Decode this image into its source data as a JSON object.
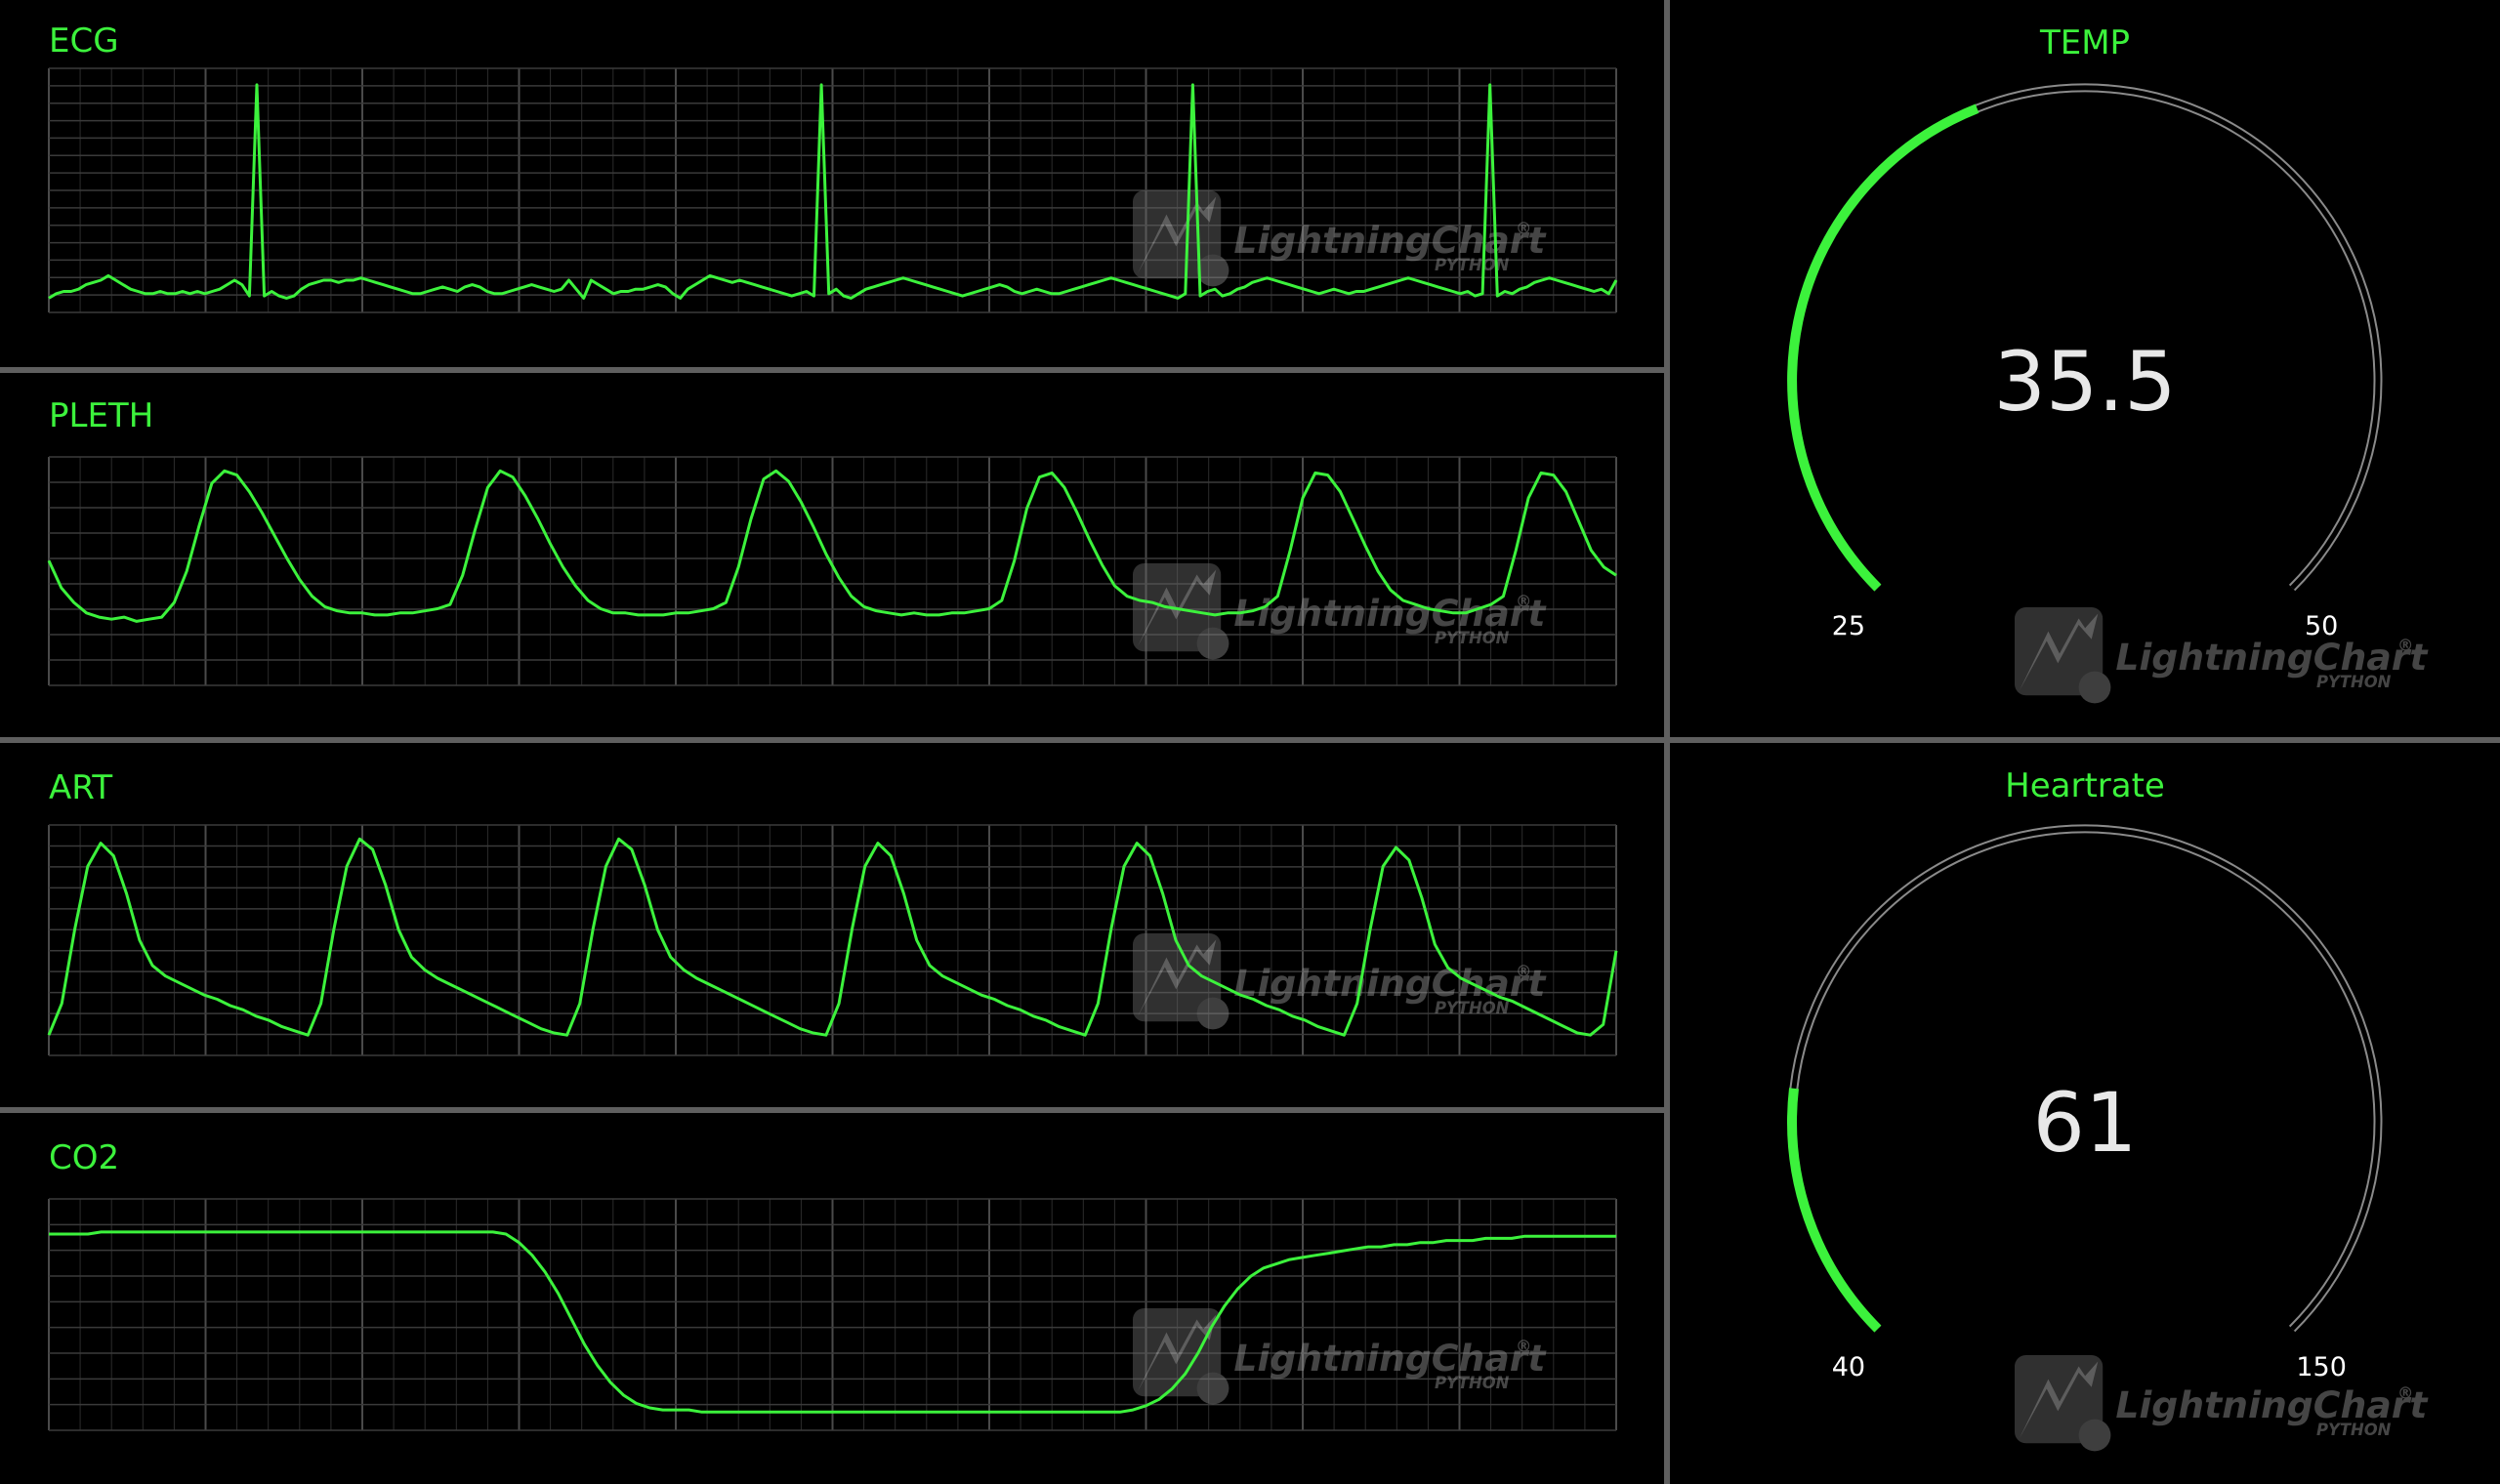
{
  "colors": {
    "background": "#000000",
    "trace": "#3cf23c",
    "grid": "#3a3a3a",
    "divider": "#5f5f5f",
    "gauge_track": "#9a9a9a",
    "value_text": "#e8e8e8",
    "tick_text": "#ffffff"
  },
  "watermark": {
    "brand": "LightningChart",
    "sub": "PYTHON",
    "icon": "lightning-python-logo-icon"
  },
  "chart_data": [
    {
      "type": "line",
      "title": "ECG",
      "xlabel": "",
      "ylabel": "",
      "grid": true,
      "series": [
        {
          "values": [
            0.02,
            0.04,
            0.05,
            0.05,
            0.06,
            0.08,
            0.09,
            0.1,
            0.12,
            0.1,
            0.08,
            0.06,
            0.05,
            0.04,
            0.04,
            0.05,
            0.04,
            0.04,
            0.05,
            0.04,
            0.05,
            0.04,
            0.05,
            0.06,
            0.08,
            0.1,
            0.08,
            0.03,
            0.97,
            0.03,
            0.05,
            0.03,
            0.02,
            0.03,
            0.06,
            0.08,
            0.09,
            0.1,
            0.1,
            0.09,
            0.1,
            0.1,
            0.11,
            0.1,
            0.09,
            0.08,
            0.07,
            0.06,
            0.05,
            0.04,
            0.04,
            0.05,
            0.06,
            0.07,
            0.06,
            0.05,
            0.07,
            0.08,
            0.07,
            0.05,
            0.04,
            0.04,
            0.05,
            0.06,
            0.07,
            0.08,
            0.07,
            0.06,
            0.05,
            0.06,
            0.1,
            0.06,
            0.02,
            0.1,
            0.08,
            0.06,
            0.04,
            0.05,
            0.05,
            0.06,
            0.06,
            0.07,
            0.08,
            0.07,
            0.04,
            0.02,
            0.06,
            0.08,
            0.1,
            0.12,
            0.11,
            0.1,
            0.09,
            0.1,
            0.09,
            0.08,
            0.07,
            0.06,
            0.05,
            0.04,
            0.03,
            0.04,
            0.05,
            0.03,
            0.97,
            0.04,
            0.06,
            0.03,
            0.02,
            0.04,
            0.06,
            0.07,
            0.08,
            0.09,
            0.1,
            0.11,
            0.1,
            0.09,
            0.08,
            0.07,
            0.06,
            0.05,
            0.04,
            0.03,
            0.04,
            0.05,
            0.06,
            0.07,
            0.08,
            0.07,
            0.05,
            0.04,
            0.05,
            0.06,
            0.05,
            0.04,
            0.04,
            0.05,
            0.06,
            0.07,
            0.08,
            0.09,
            0.1,
            0.11,
            0.1,
            0.09,
            0.08,
            0.07,
            0.06,
            0.05,
            0.04,
            0.03,
            0.02,
            0.04,
            0.97,
            0.03,
            0.05,
            0.06,
            0.03,
            0.04,
            0.06,
            0.07,
            0.09,
            0.1,
            0.11,
            0.1,
            0.09,
            0.08,
            0.07,
            0.06,
            0.05,
            0.04,
            0.05,
            0.06,
            0.05,
            0.04,
            0.05,
            0.05,
            0.06,
            0.07,
            0.08,
            0.09,
            0.1,
            0.11,
            0.1,
            0.09,
            0.08,
            0.07,
            0.06,
            0.05,
            0.04,
            0.05,
            0.03,
            0.04,
            0.97,
            0.03,
            0.05,
            0.04,
            0.06,
            0.07,
            0.09,
            0.1,
            0.11,
            0.1,
            0.09,
            0.08,
            0.07,
            0.06,
            0.05,
            0.06,
            0.04,
            0.1
          ]
        }
      ]
    },
    {
      "type": "line",
      "title": "PLETH",
      "xlabel": "",
      "ylabel": "",
      "grid": true,
      "series": [
        {
          "values": [
            0.55,
            0.42,
            0.35,
            0.3,
            0.28,
            0.27,
            0.28,
            0.26,
            0.27,
            0.28,
            0.35,
            0.5,
            0.72,
            0.92,
            0.98,
            0.96,
            0.88,
            0.78,
            0.67,
            0.56,
            0.46,
            0.38,
            0.33,
            0.31,
            0.3,
            0.3,
            0.29,
            0.29,
            0.3,
            0.3,
            0.31,
            0.32,
            0.34,
            0.48,
            0.7,
            0.9,
            0.98,
            0.95,
            0.86,
            0.75,
            0.63,
            0.52,
            0.43,
            0.36,
            0.32,
            0.3,
            0.3,
            0.29,
            0.29,
            0.29,
            0.3,
            0.3,
            0.31,
            0.32,
            0.35,
            0.52,
            0.75,
            0.94,
            0.98,
            0.93,
            0.83,
            0.71,
            0.58,
            0.47,
            0.38,
            0.33,
            0.31,
            0.3,
            0.29,
            0.3,
            0.29,
            0.29,
            0.3,
            0.3,
            0.31,
            0.32,
            0.36,
            0.55,
            0.8,
            0.95,
            0.97,
            0.9,
            0.78,
            0.65,
            0.53,
            0.43,
            0.38,
            0.36,
            0.35,
            0.33,
            0.32,
            0.31,
            0.3,
            0.29,
            0.3,
            0.3,
            0.31,
            0.33,
            0.38,
            0.6,
            0.85,
            0.97,
            0.96,
            0.88,
            0.75,
            0.62,
            0.5,
            0.41,
            0.36,
            0.34,
            0.32,
            0.31,
            0.3,
            0.3,
            0.32,
            0.34,
            0.38,
            0.6,
            0.85,
            0.97,
            0.96,
            0.88,
            0.74,
            0.6,
            0.52,
            0.48
          ]
        }
      ]
    },
    {
      "type": "line",
      "title": "ART",
      "xlabel": "",
      "ylabel": "",
      "grid": true,
      "series": [
        {
          "values": [
            0.05,
            0.2,
            0.55,
            0.85,
            0.96,
            0.9,
            0.72,
            0.5,
            0.38,
            0.33,
            0.3,
            0.27,
            0.24,
            0.22,
            0.19,
            0.17,
            0.14,
            0.12,
            0.09,
            0.07,
            0.05,
            0.2,
            0.55,
            0.85,
            0.98,
            0.93,
            0.76,
            0.55,
            0.42,
            0.36,
            0.32,
            0.29,
            0.26,
            0.23,
            0.2,
            0.17,
            0.14,
            0.11,
            0.08,
            0.06,
            0.05,
            0.2,
            0.55,
            0.85,
            0.98,
            0.93,
            0.76,
            0.55,
            0.42,
            0.36,
            0.32,
            0.29,
            0.26,
            0.23,
            0.2,
            0.17,
            0.14,
            0.11,
            0.08,
            0.06,
            0.05,
            0.2,
            0.55,
            0.85,
            0.96,
            0.9,
            0.72,
            0.5,
            0.38,
            0.33,
            0.3,
            0.27,
            0.24,
            0.22,
            0.19,
            0.17,
            0.14,
            0.12,
            0.09,
            0.07,
            0.05,
            0.2,
            0.55,
            0.85,
            0.96,
            0.9,
            0.72,
            0.5,
            0.38,
            0.33,
            0.3,
            0.27,
            0.24,
            0.22,
            0.19,
            0.17,
            0.14,
            0.12,
            0.09,
            0.07,
            0.05,
            0.2,
            0.55,
            0.85,
            0.94,
            0.88,
            0.7,
            0.48,
            0.37,
            0.32,
            0.29,
            0.26,
            0.23,
            0.21,
            0.18,
            0.15,
            0.12,
            0.09,
            0.06,
            0.05,
            0.1,
            0.45
          ]
        }
      ]
    },
    {
      "type": "line",
      "title": "CO2",
      "xlabel": "",
      "ylabel": "",
      "grid": true,
      "series": [
        {
          "values": [
            0.88,
            0.88,
            0.88,
            0.88,
            0.89,
            0.89,
            0.89,
            0.89,
            0.89,
            0.89,
            0.89,
            0.89,
            0.89,
            0.89,
            0.89,
            0.89,
            0.89,
            0.89,
            0.89,
            0.89,
            0.89,
            0.89,
            0.89,
            0.89,
            0.89,
            0.89,
            0.89,
            0.89,
            0.89,
            0.89,
            0.89,
            0.89,
            0.89,
            0.89,
            0.89,
            0.88,
            0.84,
            0.78,
            0.7,
            0.6,
            0.48,
            0.36,
            0.26,
            0.18,
            0.12,
            0.08,
            0.06,
            0.05,
            0.05,
            0.05,
            0.04,
            0.04,
            0.04,
            0.04,
            0.04,
            0.04,
            0.04,
            0.04,
            0.04,
            0.04,
            0.04,
            0.04,
            0.04,
            0.04,
            0.04,
            0.04,
            0.04,
            0.04,
            0.04,
            0.04,
            0.04,
            0.04,
            0.04,
            0.04,
            0.04,
            0.04,
            0.04,
            0.04,
            0.04,
            0.04,
            0.04,
            0.04,
            0.04,
            0.05,
            0.07,
            0.1,
            0.15,
            0.22,
            0.32,
            0.44,
            0.54,
            0.62,
            0.68,
            0.72,
            0.74,
            0.76,
            0.77,
            0.78,
            0.79,
            0.8,
            0.81,
            0.82,
            0.82,
            0.83,
            0.83,
            0.84,
            0.84,
            0.85,
            0.85,
            0.85,
            0.86,
            0.86,
            0.86,
            0.87,
            0.87,
            0.87,
            0.87,
            0.87,
            0.87,
            0.87,
            0.87
          ]
        }
      ]
    }
  ],
  "gauges": [
    {
      "title": "TEMP",
      "value_text": "35.5",
      "value": 35.5,
      "min": 25,
      "max": 50,
      "min_label": "25",
      "max_label": "50"
    },
    {
      "title": "Heartrate",
      "value_text": "61",
      "value": 61,
      "min": 40,
      "max": 150,
      "min_label": "40",
      "max_label": "150"
    }
  ]
}
